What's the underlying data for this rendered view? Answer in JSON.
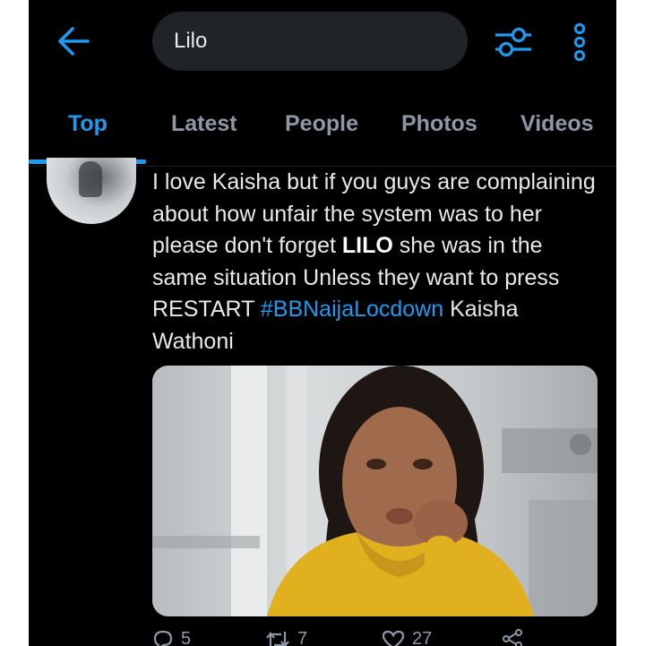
{
  "search": {
    "query": "Lilo"
  },
  "icons": {
    "back": "arrow-left-icon",
    "filter": "sliders-icon",
    "more": "kebab-vertical-icon",
    "reply": "reply-icon",
    "retweet": "retweet-icon",
    "like": "heart-icon",
    "share": "share-icon"
  },
  "tabs": [
    {
      "label": "Top",
      "active": true
    },
    {
      "label": "Latest",
      "active": false
    },
    {
      "label": "People",
      "active": false
    },
    {
      "label": "Photos",
      "active": false
    },
    {
      "label": "Videos",
      "active": false
    }
  ],
  "tweet": {
    "text_parts": {
      "part1": "I love Kaisha but if you guys are complaining about how unfair the system was to her please don't forget ",
      "bold": "LILO",
      "part2": " she was in the same situation Unless they want to press RESTART ",
      "hashtag": "#BBNaijaLocdown",
      "part3": " Kaisha Wathoni"
    },
    "actions": {
      "reply_count": "5",
      "retweet_count": "7",
      "like_count": "27"
    }
  },
  "colors": {
    "accent": "#1d9bf0",
    "background": "#000000",
    "text": "#e7e9ea",
    "muted": "#8b98a5",
    "search_bg": "#202327"
  }
}
